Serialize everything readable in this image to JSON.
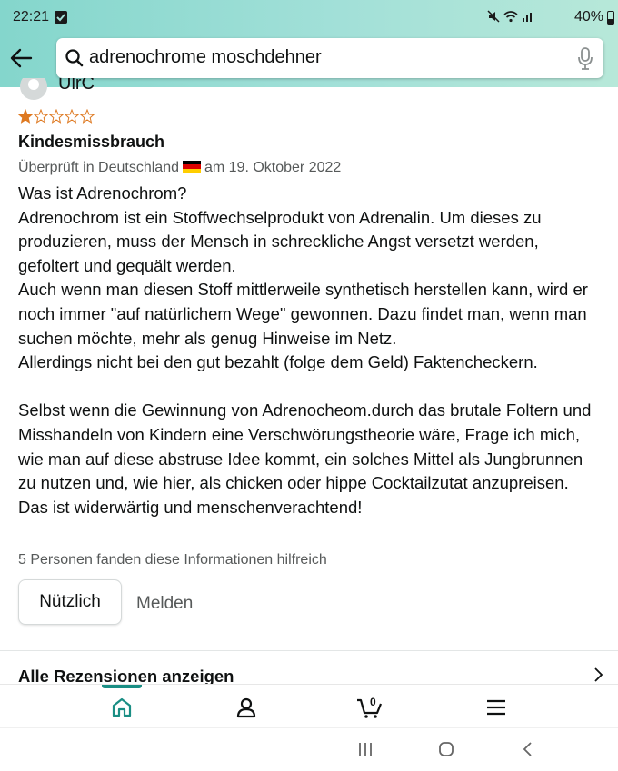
{
  "status_bar": {
    "time": "22:21",
    "battery": "40%"
  },
  "search": {
    "query": "adrenochrome moschdehner"
  },
  "review": {
    "username": "UlrC",
    "rating": 1,
    "rating_max": 5,
    "title": "Kindesmissbrauch",
    "meta_prefix": "Überprüft in Deutschland",
    "meta_suffix": "am 19. Oktober 2022",
    "body_paragraph_1": "Was ist Adrenochrom?\nAdrenochrom ist ein Stoffwechselprodukt von Adrenalin. Um dieses zu produzieren, muss der Mensch in schreckliche Angst versetzt werden, gefoltert und gequält werden.\nAuch wenn man diesen Stoff mittlerweile synthetisch herstellen kann, wird er noch immer \"auf natürlichem Wege\" gewonnen. Dazu findet man, wenn man suchen möchte, mehr als genug Hinweise im Netz.\nAllerdings nicht bei den gut bezahlt (folge dem Geld) Faktencheckern.",
    "body_paragraph_2": "Selbst wenn die Gewinnung von Adrenocheom.durch das brutale Foltern und Misshandeln von Kindern eine Verschwörungstheorie wäre, Frage ich mich, wie man auf diese abstruse Idee kommt, ein solches Mittel als Jungbrunnen zu nutzen und, wie hier, als chicken oder hippe Cocktailzutat anzupreisen.\nDas ist widerwärtig und menschenverachtend!",
    "helpful_text": "5 Personen fanden diese Informationen hilfreich",
    "useful_label": "Nützlich",
    "report_label": "Melden"
  },
  "all_reviews_label": "Alle Rezensionen anzeigen",
  "bottom_nav": {
    "cart_count": "0",
    "active": "home"
  },
  "colors": {
    "header_start": "#84d6cc",
    "header_end": "#b7e8d9",
    "star_fill": "#de7921",
    "active_nav": "#1a8e84"
  }
}
